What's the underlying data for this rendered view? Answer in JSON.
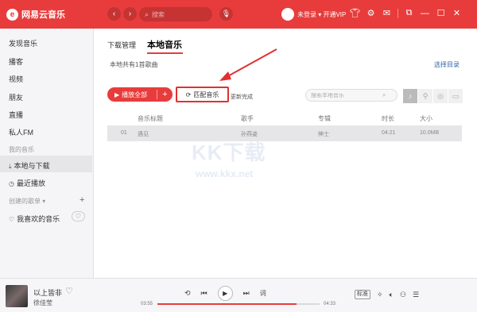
{
  "app": {
    "logo_text": "网易云音乐",
    "logo_glyph": "e"
  },
  "topbar": {
    "search_placeholder": "搜索",
    "user_text": "未登录 ▾ 开通VIP"
  },
  "sidebar": {
    "items": [
      {
        "label": "发现音乐"
      },
      {
        "label": "播客"
      },
      {
        "label": "视频"
      },
      {
        "label": "朋友"
      },
      {
        "label": "直播"
      },
      {
        "label": "私人FM"
      }
    ],
    "section_my": "我的音乐",
    "my_items": [
      {
        "label": "本地与下载"
      },
      {
        "label": "最近播放"
      }
    ],
    "section_created": "创建的歌单 ▾",
    "playlists": [
      {
        "label": "我喜欢的音乐"
      }
    ]
  },
  "main": {
    "tabs": [
      {
        "label": "下载管理"
      },
      {
        "label": "本地音乐"
      }
    ],
    "count_text": "本地共有1首歌曲",
    "select_dir": "选择目录",
    "play_all": "播放全部",
    "match_button": "匹配音乐",
    "update_text": "更新完成",
    "local_search_placeholder": "搜索本地音乐",
    "table": {
      "headers": [
        "音乐标题",
        "歌手",
        "专辑",
        "时长",
        "大小"
      ],
      "rows": [
        {
          "index": "01",
          "title": "遇见",
          "artist": "孙燕姿",
          "album": "绅士",
          "duration": "04:21",
          "size": "10.0MB"
        }
      ]
    },
    "watermark": {
      "big": "KK下载",
      "small": "www.kkx.net"
    }
  },
  "player": {
    "song_title": "以上皆非",
    "artist": "徐佳莹",
    "lyric_label": "词",
    "time_current": "03:55",
    "time_total": "04:33",
    "progress": 0.86,
    "quality_label": "标准"
  },
  "colors": {
    "accent": "#e83c3c",
    "annotation": "#e23030"
  }
}
